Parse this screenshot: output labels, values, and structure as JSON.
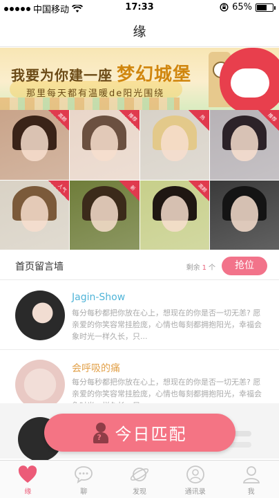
{
  "status_bar": {
    "carrier": "中国移动",
    "time": "17:33",
    "battery": "65%",
    "battery_level": 0.65
  },
  "nav": {
    "title": "缘"
  },
  "banner": {
    "headline": "我要为你建一座",
    "headline_big": "梦幻城堡",
    "subline": "那里每天都有温暖de阳光围绕"
  },
  "photos": [
    {
      "badge": "高颜"
    },
    {
      "badge": "推荐"
    },
    {
      "badge": "热"
    },
    {
      "badge": "推荐"
    },
    {
      "badge": "人气"
    },
    {
      "badge": "新"
    },
    {
      "badge": "高颜"
    },
    {
      "badge": ""
    }
  ],
  "wall": {
    "title": "首页留言墙",
    "remain_prefix": "剩余",
    "remain_count": "1",
    "remain_suffix": "个",
    "grab_button": "抢位"
  },
  "messages": [
    {
      "name": "Jagin-Show",
      "name_color": "#4fb4d8",
      "text": "每分每秒都把你放在心上，想现在的你是否一切无恙? 愿亲爱的你笑容常挂脸庞，心情也每刻都拥抱阳光，幸福会象时光一样久长，只..."
    },
    {
      "name": "会呼吸的痛",
      "name_color": "#e2a14a",
      "text": "每分每秒都把你放在心上，想现在的你是否一切无恙? 愿亲爱的你笑容常挂脸庞，心情也每刻都拥抱阳光，幸福会象时光一样久长，只..."
    }
  ],
  "match_button": {
    "label": "今日匹配"
  },
  "tabs": [
    {
      "label": "缘",
      "icon": "heart-icon",
      "active": true
    },
    {
      "label": "聊",
      "icon": "chat-bubble-icon",
      "active": false
    },
    {
      "label": "发现",
      "icon": "planet-icon",
      "active": false
    },
    {
      "label": "通讯录",
      "icon": "contacts-icon",
      "active": false
    },
    {
      "label": "我",
      "icon": "user-icon",
      "active": false
    }
  ],
  "colors": {
    "accent": "#f2738a",
    "active_tab": "#ec5b78"
  }
}
